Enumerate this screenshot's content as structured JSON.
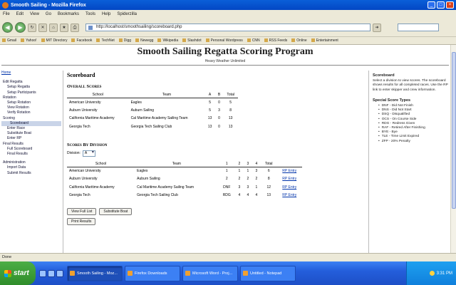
{
  "window": {
    "title": "Smooth Sailing - Mozilla Firefox"
  },
  "menubar": [
    "File",
    "Edit",
    "View",
    "Go",
    "Bookmarks",
    "Tools",
    "Help",
    "Spiderzilla"
  ],
  "navbar": {
    "url": "http://localhost/smoothsailing/scoreboard.php"
  },
  "bookmarks": [
    "Gmail",
    "Yahoo!",
    "MIT Directory",
    "Facebook",
    "TechNet",
    "Digg",
    "Newegg",
    "Wikipedia",
    "Slashdot",
    "Personal Wordpress",
    "CNN",
    "RSS Feeds",
    "Online",
    "Entertainment"
  ],
  "site": {
    "title": "Smooth Sailing Regatta Scoring Program",
    "subtitle": "Heavy Weather Unlimited"
  },
  "leftnav": {
    "home": "Home",
    "items": [
      {
        "label": "Edit Regatta",
        "level": 1
      },
      {
        "label": "Setup Regatta",
        "level": 2
      },
      {
        "label": "Setup Participants",
        "level": 2
      },
      {
        "label": "Rotation",
        "level": 1
      },
      {
        "label": "Setup Rotation",
        "level": 2
      },
      {
        "label": "View Rotation",
        "level": 2
      },
      {
        "label": "Verify Rotation",
        "level": 2
      },
      {
        "label": "Scoring",
        "level": 1
      },
      {
        "label": "Scoreboard",
        "level": 3,
        "active": true
      },
      {
        "label": "Enter Race",
        "level": 2
      },
      {
        "label": "Substitute Boat",
        "level": 2
      },
      {
        "label": "Enter RP",
        "level": 2
      },
      {
        "label": "Final Results",
        "level": 1
      },
      {
        "label": "Full Scoreboard",
        "level": 2
      },
      {
        "label": "Final Results",
        "level": 2
      },
      {
        "gap": true
      },
      {
        "label": "Administration",
        "level": 1
      },
      {
        "label": "Import Data",
        "level": 2
      },
      {
        "label": "Submit Results",
        "level": 2
      }
    ]
  },
  "main": {
    "heading": "Scoreboard",
    "overall": {
      "heading": "Overall Scores",
      "columns": [
        "School",
        "Team",
        "A",
        "B",
        "Total"
      ],
      "rows": [
        [
          "American University",
          "Eagles",
          "5",
          "0",
          "5"
        ],
        [
          "Auburn University",
          "Auburn Sailing",
          "5",
          "3",
          "8"
        ],
        [
          "California Maritime Academy",
          "Cal Maritime Academy Sailing Team",
          "13",
          "0",
          "13"
        ],
        [
          "Georgia Tech",
          "Georgia Tech Sailing Club",
          "13",
          "0",
          "13"
        ]
      ]
    },
    "division": {
      "heading": "Scores By Division",
      "select_label": "Division:",
      "select_value": "A",
      "columns": [
        "School",
        "Team",
        "1",
        "2",
        "3",
        "4",
        "Total",
        ""
      ],
      "rows": [
        [
          "American University",
          "Eagles",
          "1",
          "1",
          "1",
          "3",
          "6",
          "RP Entry"
        ],
        [
          "Auburn University",
          "Auburn Sailing",
          "2",
          "2",
          "2",
          "2",
          "8",
          "RP Entry"
        ],
        [
          "California Maritime Academy",
          "Cal Maritime Academy Sailing Team",
          "DNF",
          "3",
          "3",
          "1",
          "12",
          "RP Entry"
        ],
        [
          "Georgia Tech",
          "Georgia Tech Sailing Club",
          "RDG",
          "4",
          "4",
          "4",
          "13",
          "RP Entry"
        ]
      ]
    },
    "buttons": {
      "view_full": "View Full List",
      "substitute": "Substitute Boat",
      "print": "Print Results"
    }
  },
  "rightbar": {
    "heading": "Scoreboard",
    "text": "Select a division to view scores. The scoreboard shows results for all completed races. Use the RP link to enter skipper and crew information.",
    "special_heading": "Special Score Types",
    "special": [
      "DNF - Did Not Finish",
      "DNS - Did Not Start",
      "DSQ - Disqualified",
      "OCS - On Course Side",
      "RDG - Redress Given",
      "RAF - Retired After Finishing",
      "BYE - Bye",
      "TLE - Time Limit Expired",
      "ZFP - 20% Penalty"
    ]
  },
  "statusbar": {
    "text": "Done"
  },
  "taskbar": {
    "start": "start",
    "tasks": [
      "Smooth Sailing - Moz...",
      "Firefox Downloads",
      "Microsoft Word - Proj...",
      "Untitled - Notepad"
    ],
    "clock": "3:31 PM"
  }
}
